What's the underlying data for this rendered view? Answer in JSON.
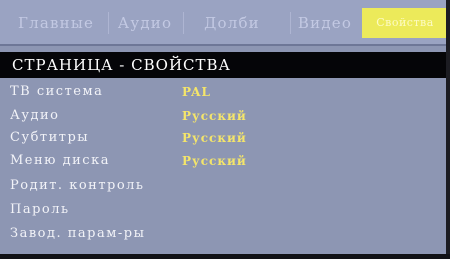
{
  "tabs": [
    {
      "label": "Главные"
    },
    {
      "label": "Аудио"
    },
    {
      "label": "Долби"
    },
    {
      "label": "Видео"
    },
    {
      "label": "Свойства",
      "active": true
    }
  ],
  "page": {
    "title": "СТРАНИЦА  -  СВОЙСТВА"
  },
  "settings": [
    {
      "label": "ТВ система",
      "value": "PAL"
    },
    {
      "label": "Аудио",
      "value": "Русский"
    },
    {
      "label": "Субтитры",
      "value": "Русский"
    },
    {
      "label": "Меню диска",
      "value": "Русский"
    },
    {
      "label": "Родит. контроль",
      "value": ""
    },
    {
      "label": "Пароль",
      "value": ""
    },
    {
      "label": "Завод. парам-ры",
      "value": ""
    }
  ],
  "colors": {
    "background": "#8d96b3",
    "tab_active": "#ecea5a",
    "header_bar": "#050508",
    "value_text": "#f4e56a"
  }
}
